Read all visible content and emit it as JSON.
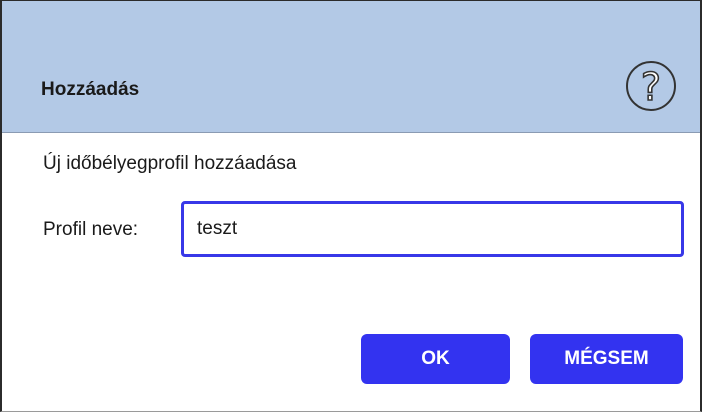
{
  "dialog": {
    "title": "Hozzáadás",
    "help_icon": "question-mark-circle-icon",
    "help_glyph": "?",
    "subtitle": "Új időbélyegprofil hozzáadása",
    "field_label": "Profil neve:",
    "field_value": "teszt",
    "ok_label": "OK",
    "cancel_label": "MÉGSEM"
  },
  "colors": {
    "titlebar": "#b3c9e6",
    "accent": "#3333f0",
    "input_border": "#3838e8",
    "text": "#1a1a1a"
  }
}
